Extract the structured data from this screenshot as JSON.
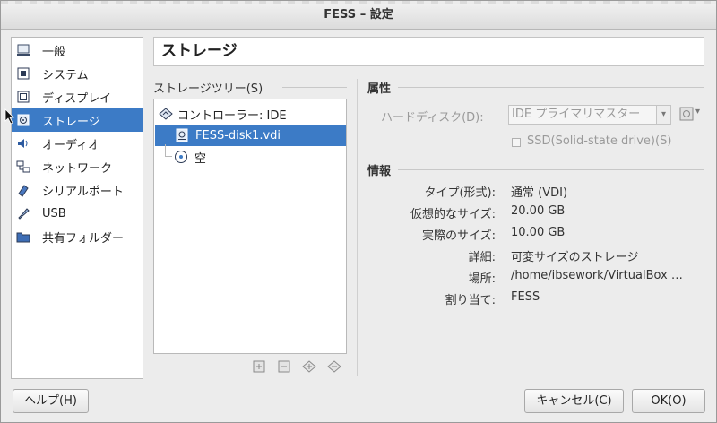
{
  "window": {
    "title": "FESS – 設定"
  },
  "sidebar": {
    "items": [
      {
        "label": "一般",
        "icon": "general-icon"
      },
      {
        "label": "システム",
        "icon": "system-icon"
      },
      {
        "label": "ディスプレイ",
        "icon": "display-icon"
      },
      {
        "label": "ストレージ",
        "icon": "storage-icon",
        "selected": true
      },
      {
        "label": "オーディオ",
        "icon": "audio-icon"
      },
      {
        "label": "ネットワーク",
        "icon": "network-icon"
      },
      {
        "label": "シリアルポート",
        "icon": "serial-port-icon"
      },
      {
        "label": "USB",
        "icon": "usb-icon"
      },
      {
        "label": "共有フォルダー",
        "icon": "shared-folder-icon"
      }
    ]
  },
  "page": {
    "title": "ストレージ"
  },
  "storage_tree": {
    "legend": "ストレージツリー(S)",
    "controller": "コントローラー: IDE",
    "disk": "FESS-disk1.vdi",
    "empty": "空"
  },
  "attributes": {
    "title": "属性",
    "hard_disk_label": "ハードディスク(D):",
    "hard_disk_value": "IDE プライマリマスター",
    "ssd_label": "SSD(Solid-state drive)(S)"
  },
  "info": {
    "title": "情報",
    "rows": [
      {
        "key": "タイプ(形式):",
        "value": "通常 (VDI)"
      },
      {
        "key": "仮想的なサイズ:",
        "value": "20.00 GB"
      },
      {
        "key": "実際のサイズ:",
        "value": "10.00 GB"
      },
      {
        "key": "詳細:",
        "value": "可変サイズのストレージ"
      },
      {
        "key": "場所:",
        "value": "/home/ibsework/VirtualBox …"
      },
      {
        "key": "割り当て:",
        "value": "FESS"
      }
    ]
  },
  "buttons": {
    "help": "ヘルプ(H)",
    "cancel": "キャンセル(C)",
    "ok": "OK(O)"
  },
  "colors": {
    "selection": "#3c7bc6"
  }
}
